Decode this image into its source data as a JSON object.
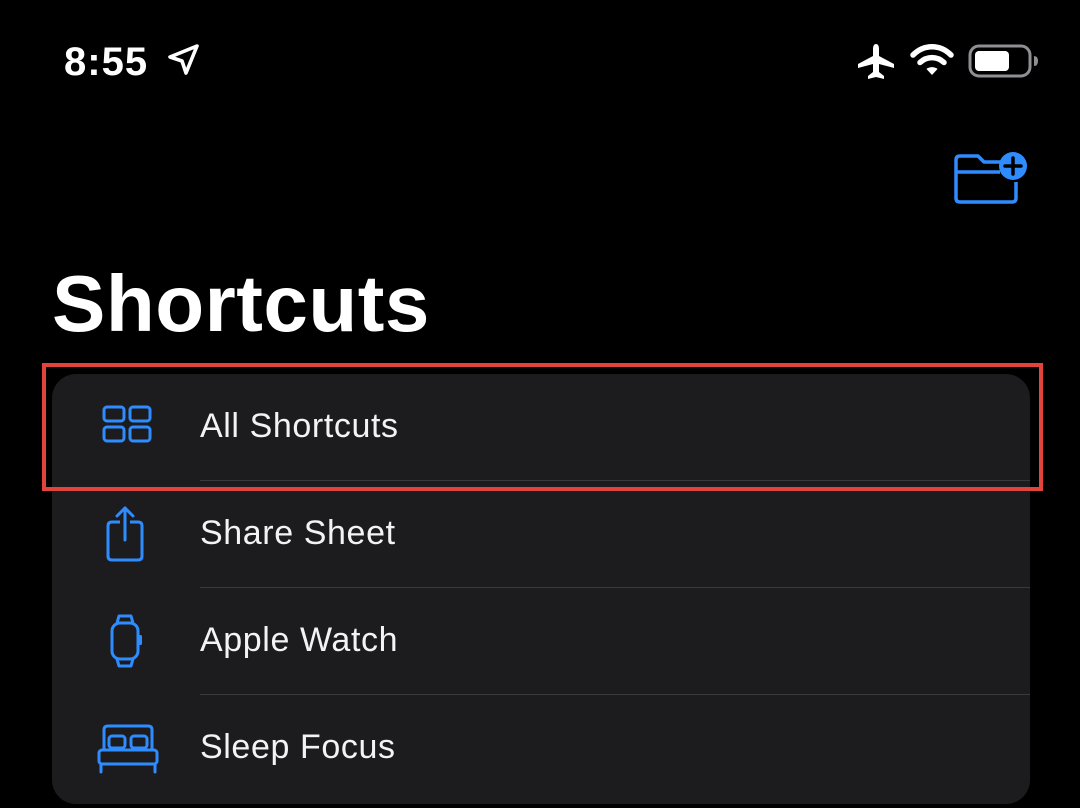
{
  "status_bar": {
    "time": "8:55",
    "icons": [
      "location-arrow-icon",
      "airplane-icon",
      "wifi-icon",
      "battery-icon"
    ]
  },
  "toolbar": {
    "new_folder_icon": "folder-plus-icon"
  },
  "page": {
    "title": "Shortcuts"
  },
  "list": {
    "items": [
      {
        "label": "All Shortcuts",
        "icon": "grid-icon",
        "highlighted": true
      },
      {
        "label": "Share Sheet",
        "icon": "share-icon"
      },
      {
        "label": "Apple Watch",
        "icon": "watch-icon"
      },
      {
        "label": "Sleep Focus",
        "icon": "bed-icon"
      }
    ]
  },
  "colors": {
    "background": "#000000",
    "card": "#1c1c1e",
    "accent": "#2f8cff",
    "text": "#f2f2f7",
    "divider": "#3a3a3c",
    "highlight": "#e0443a"
  }
}
